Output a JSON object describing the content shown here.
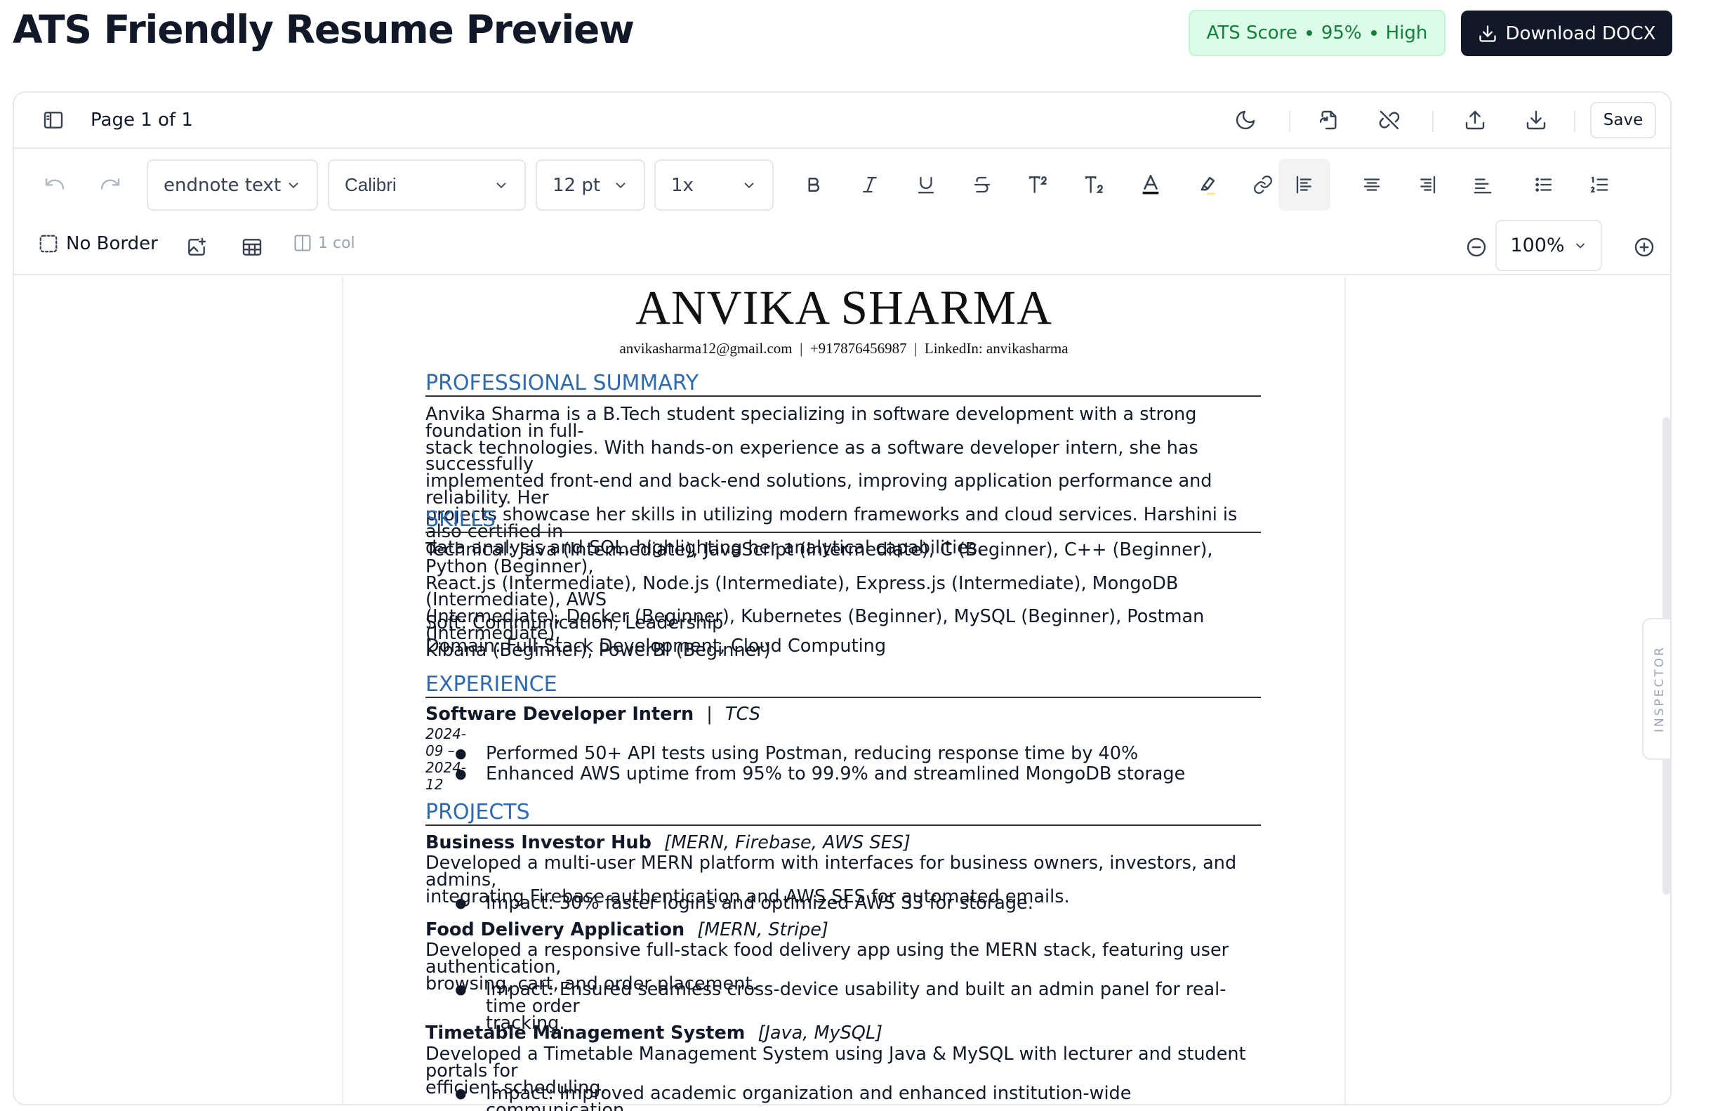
{
  "header": {
    "title": "ATS Friendly Resume Preview",
    "ats_label": "ATS Score",
    "ats_value": "95%",
    "ats_level": "High",
    "download_label": "Download DOCX"
  },
  "toolbar": {
    "page_indicator": "Page 1 of 1",
    "save_label": "Save",
    "style_select": "endnote text",
    "font_select": "Calibri",
    "size_select": "12 pt",
    "spacing_select": "1x",
    "border_label": "No Border",
    "columns_label": "1 col",
    "zoom_value": "100%"
  },
  "inspector_label": "INSPECTOR",
  "resume": {
    "name": "ANVIKA SHARMA",
    "contact": "anvikasharma12@gmail.com  |  +917876456987  |  LinkedIn: anvikasharma",
    "summary_heading": "PROFESSIONAL SUMMARY",
    "summary_lines": [
      "Anvika Sharma is a B.Tech student specializing in software development with a strong foundation in full-",
      "stack technologies. With hands-on experience as a software developer intern, she has successfully",
      "implemented front-end and back-end solutions, improving application performance and reliability. Her",
      "projects showcase her skills in utilizing modern frameworks and cloud services. Harshini is also certified in",
      "data analysis and SQL, highlighting her analytical capabilities."
    ],
    "skills_heading": "SKILLS",
    "skills_technical_lines": [
      "Technical: Java (Intermediate), JavaScript (Intermediate), C (Beginner), C++ (Beginner), Python (Beginner),",
      "React.js (Intermediate), Node.js (Intermediate), Express.js (Intermediate), MongoDB (Intermediate), AWS",
      "(Intermediate), Docker (Beginner), Kubernetes (Beginner), MySQL (Beginner), Postman (Intermediate),",
      "Kibana (Beginner), PowerBI (Beginner)"
    ],
    "skills_soft": "Soft: Communication, Leadership",
    "skills_domain": "Domain: Full-Stack Development, Cloud Computing",
    "experience_heading": "EXPERIENCE",
    "exp_role": "Software Developer Intern",
    "exp_sep": "|",
    "exp_company": "TCS",
    "exp_dates": "2024-09 – 2024-12",
    "exp_bullets": [
      "Performed 50+ API tests using Postman, reducing response time by 40%",
      "Enhanced AWS uptime from 95% to 99.9% and streamlined MongoDB storage"
    ],
    "projects_heading": "PROJECTS",
    "projects": [
      {
        "title": "Business Investor Hub",
        "tech": "[MERN, Firebase, AWS SES]",
        "desc_lines": [
          "Developed a multi-user MERN platform with interfaces for business owners, investors, and admins,",
          "integrating Firebase authentication and AWS SES for automated emails."
        ],
        "bullet_lines": [
          "Impact: 30% faster logins and optimized AWS S3 for storage."
        ]
      },
      {
        "title": "Food Delivery Application",
        "tech": "[MERN, Stripe]",
        "desc_lines": [
          "Developed a responsive full-stack food delivery app using the MERN stack, featuring user authentication,",
          "browsing, cart, and order placement."
        ],
        "bullet_lines": [
          "Impact: Ensured seamless cross-device usability and built an admin panel for real-time order",
          "tracking."
        ]
      },
      {
        "title": "Timetable Management System",
        "tech": "[Java, MySQL]",
        "desc_lines": [
          "Developed a Timetable Management System using Java & MySQL with lecturer and student portals for",
          "efficient scheduling."
        ],
        "bullet_lines": [
          "Impact: Improved academic organization and enhanced institution-wide communication."
        ]
      }
    ]
  },
  "colors": {
    "accent_heading": "#2f6aae",
    "ats_bg": "#dcfce7",
    "ats_text": "#15803d",
    "primary_button": "#111827"
  }
}
